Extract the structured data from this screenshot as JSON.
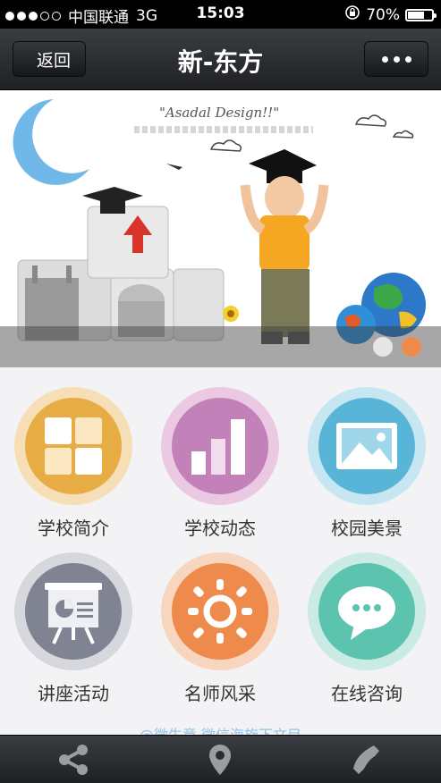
{
  "status_bar": {
    "carrier": "中国联通",
    "network": "3G",
    "time": "15:03",
    "battery": "70%",
    "battery_level": 0.7,
    "signal_bars_filled": 3,
    "signal_bars_total": 5
  },
  "nav": {
    "back_label": "返回",
    "title": "新-东方",
    "more_icon": "more-dots-icon"
  },
  "banner": {
    "caption": "\"Asadal Design!!\"",
    "pager_active_index": 1,
    "pager_count": 2,
    "colors": {
      "pager_inactive": "#e6e6e6",
      "pager_active": "#f08a4b"
    }
  },
  "menu": {
    "items": [
      {
        "label": "学校简介",
        "icon": "grid-tiles-icon",
        "ring": "#f6dfb6",
        "core": "#e8ac45"
      },
      {
        "label": "学校动态",
        "icon": "bar-chart-icon",
        "ring": "#ebc9e3",
        "core": "#c281b9"
      },
      {
        "label": "校园美景",
        "icon": "picture-icon",
        "ring": "#c6e6f1",
        "core": "#58b5d8"
      },
      {
        "label": "讲座活动",
        "icon": "presentation-board-icon",
        "ring": "#d6d8de",
        "core": "#7f8392"
      },
      {
        "label": "名师风采",
        "icon": "sun-icon",
        "ring": "#f7d5be",
        "core": "#ef8a4d"
      },
      {
        "label": "在线咨询",
        "icon": "chat-bubble-icon",
        "ring": "#c9ebe3",
        "core": "#5cc3ae"
      }
    ],
    "footer": "@微生意 微信海旋下文目"
  },
  "bottom_bar": {
    "items": [
      {
        "icon": "share-icon"
      },
      {
        "icon": "location-pin-icon"
      },
      {
        "icon": "phone-icon"
      }
    ]
  }
}
